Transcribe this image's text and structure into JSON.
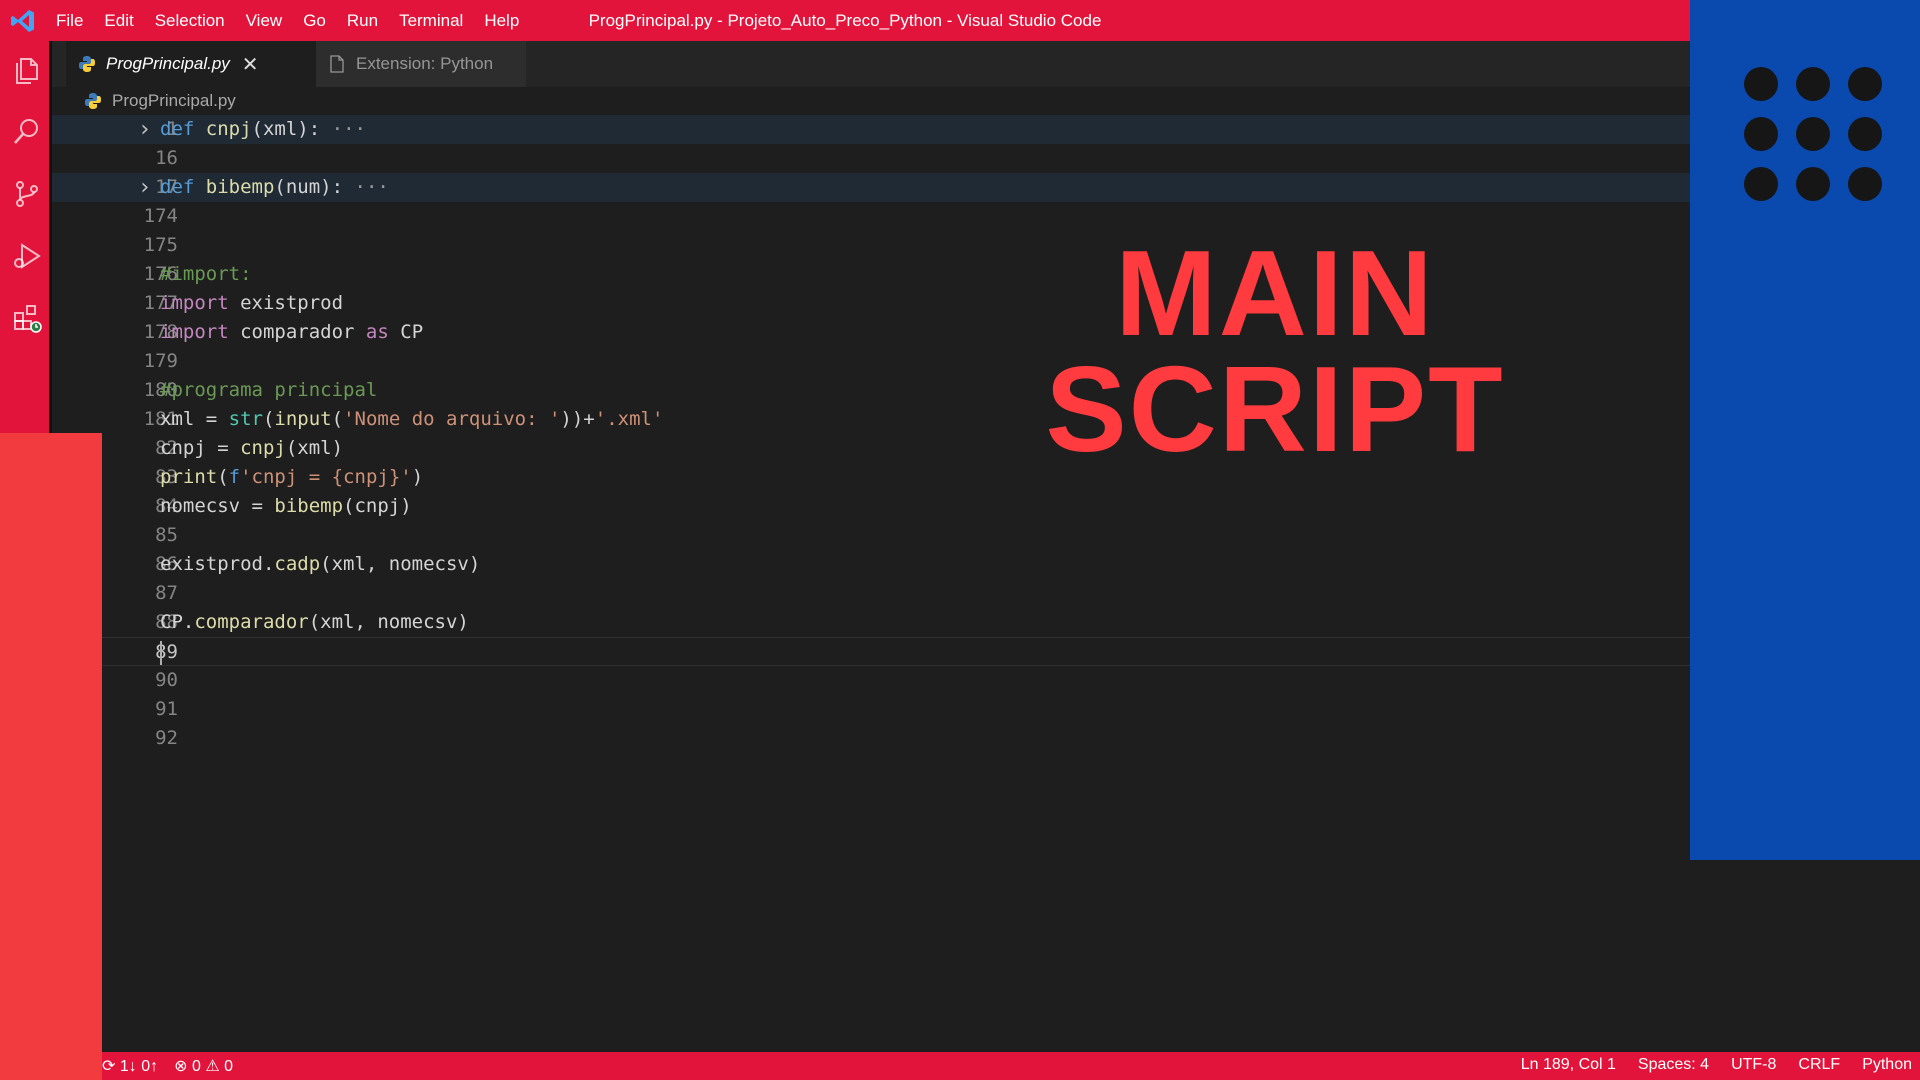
{
  "window": {
    "title": "ProgPrincipal.py - Projeto_Auto_Preco_Python - Visual Studio Code"
  },
  "menu": [
    "File",
    "Edit",
    "Selection",
    "View",
    "Go",
    "Run",
    "Terminal",
    "Help"
  ],
  "activity_bar": [
    "files-icon",
    "search-icon",
    "source-control-icon",
    "run-debug-icon",
    "extensions-icon"
  ],
  "tabs": [
    {
      "label": "ProgPrincipal.py",
      "active": true,
      "icon": "python-file-icon"
    },
    {
      "label": "Extension: Python",
      "active": false,
      "icon": "file-icon"
    }
  ],
  "breadcrumb": {
    "file": "ProgPrincipal.py"
  },
  "editor": {
    "lines": [
      {
        "n": "1",
        "text": "def cnpj(xml): ···",
        "folded": true
      },
      {
        "n": "16",
        "text": ""
      },
      {
        "n": "17",
        "text": "def bibemp(num): ···",
        "folded": true
      },
      {
        "n": "174",
        "text": ""
      },
      {
        "n": "175",
        "text": ""
      },
      {
        "n": "176",
        "text": "#import:"
      },
      {
        "n": "177",
        "text": "import existprod"
      },
      {
        "n": "178",
        "text": "import comparador as CP"
      },
      {
        "n": "179",
        "text": ""
      },
      {
        "n": "180",
        "text": "#programa principal"
      },
      {
        "n": "181",
        "text": "xml = str(input('Nome do arquivo: '))+'.xml'"
      },
      {
        "n": "82",
        "text": "cnpj = cnpj(xml)"
      },
      {
        "n": "83",
        "text": "print(f'cnpj = {cnpj}')"
      },
      {
        "n": "84",
        "text": "nomecsv = bibemp(cnpj)"
      },
      {
        "n": "85",
        "text": ""
      },
      {
        "n": "86",
        "text": "existprod.cadp(xml, nomecsv)"
      },
      {
        "n": "87",
        "text": ""
      },
      {
        "n": "88",
        "text": "CP.comparador(xml, nomecsv)"
      },
      {
        "n": "89",
        "text": "",
        "current": true
      },
      {
        "n": "90",
        "text": ""
      },
      {
        "n": "91",
        "text": ""
      },
      {
        "n": "92",
        "text": ""
      }
    ]
  },
  "overlay": {
    "headline_line1": "MAIN",
    "headline_line2": "SCRIPT"
  },
  "statusbar": {
    "sync": "1↓ 0↑",
    "errors": "0",
    "warnings": "0",
    "position": "Ln 189, Col 1",
    "spaces": "Spaces: 4",
    "encoding": "UTF-8",
    "eol": "CRLF",
    "language": "Python"
  },
  "colors": {
    "accent_red": "#e3143b",
    "overlay_red": "#f23b3f",
    "overlay_blue": "#0a4aaf",
    "headline": "#ff3b3f"
  }
}
